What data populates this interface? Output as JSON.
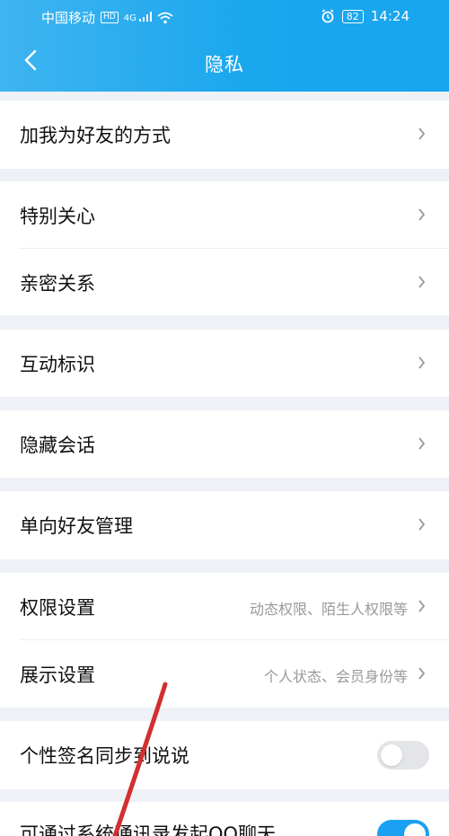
{
  "status_bar": {
    "carrier": "中国移动",
    "network_badge": "HD",
    "signal_label": "4G",
    "battery": "82",
    "time": "14:24",
    "icons": [
      "signal-icon",
      "wifi-icon",
      "alarm-icon",
      "battery-icon"
    ]
  },
  "header": {
    "title": "隐私"
  },
  "groups": [
    {
      "items": [
        {
          "label": "加我为好友的方式"
        }
      ]
    },
    {
      "items": [
        {
          "label": "特别关心"
        },
        {
          "label": "亲密关系"
        }
      ]
    },
    {
      "items": [
        {
          "label": "互动标识"
        }
      ]
    },
    {
      "items": [
        {
          "label": "隐藏会话"
        }
      ]
    },
    {
      "items": [
        {
          "label": "单向好友管理"
        }
      ]
    },
    {
      "items": [
        {
          "label": "权限设置",
          "hint": "动态权限、陌生人权限等"
        },
        {
          "label": "展示设置",
          "hint": "个人状态、会员身份等"
        }
      ]
    },
    {
      "items": [
        {
          "label": "个性签名同步到说说",
          "toggle": false
        }
      ]
    },
    {
      "items": [
        {
          "label": "可通过系统通讯录发起QQ聊天",
          "toggle": true
        }
      ]
    }
  ],
  "colors": {
    "accent": "#18a5ee",
    "annotation": "#d32f2f"
  }
}
